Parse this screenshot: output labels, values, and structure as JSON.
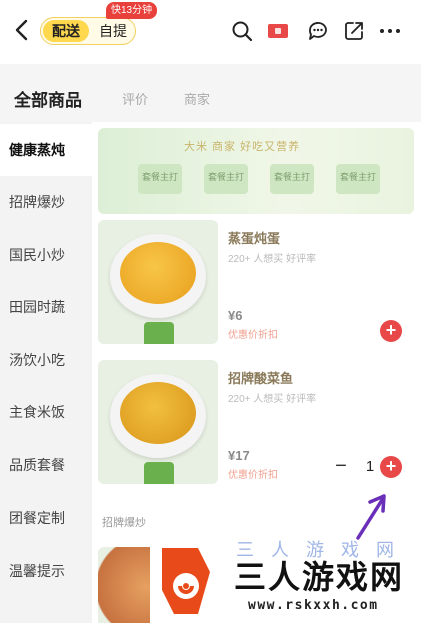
{
  "topbar": {
    "back_icon": "chevron-left-icon",
    "mode_active": "配送",
    "mode_inactive": "自提",
    "fast_badge": "快13分钟",
    "icons": [
      "search-icon",
      "red-packet-icon",
      "chat-icon",
      "share-icon",
      "more-icon"
    ]
  },
  "subhead": {
    "title": "全部商品",
    "tabs": [
      "评价",
      "商家"
    ]
  },
  "sidebar": {
    "items": [
      {
        "label": "健康蒸炖",
        "active": true
      },
      {
        "label": "招牌爆炒",
        "active": false
      },
      {
        "label": "国民小炒",
        "active": false
      },
      {
        "label": "田园时蔬",
        "active": false
      },
      {
        "label": "汤饮小吃",
        "active": false
      },
      {
        "label": "主食米饭",
        "active": false
      },
      {
        "label": "品质套餐",
        "active": false
      },
      {
        "label": "团餐定制",
        "active": false
      },
      {
        "label": "温馨提示",
        "active": false
      }
    ]
  },
  "banner": {
    "title": "大米 商家 好吃又营养",
    "chips": [
      "套餐主打",
      "套餐主打",
      "套餐主打",
      "套餐主打"
    ]
  },
  "dishes": [
    {
      "name": "蒸蛋炖蛋",
      "desc": "220+ 人想买 好评率",
      "price": "¥6",
      "promo": "优惠价折扣",
      "quantity": ""
    },
    {
      "name": "招牌酸菜鱼",
      "desc": "220+ 人想买 好评率",
      "price": "¥17",
      "promo": "优惠价折扣",
      "quantity": "1"
    }
  ],
  "section_label": "招牌爆炒",
  "watermark": {
    "name": "三人游戏网",
    "url": "www.rskxxh.com",
    "ghost": "三 人 游 戏 网"
  },
  "colors": {
    "accent_red": "#e84848",
    "mode_yellow": "#ffd84d",
    "badge_red": "#e8403a",
    "arrow_purple": "#6a2fb8"
  }
}
